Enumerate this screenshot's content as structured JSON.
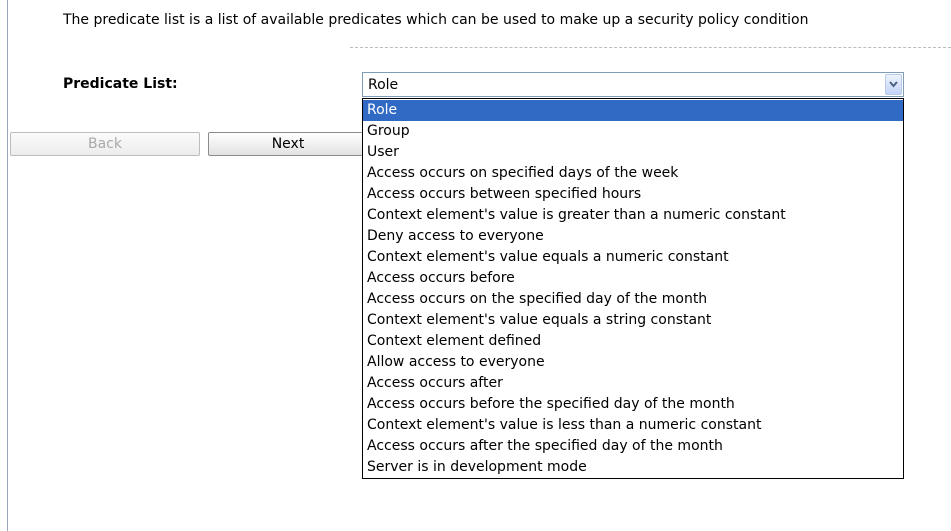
{
  "intro_text": "The predicate list is a list of available predicates which can be used to make up a security policy condition",
  "predicate_list": {
    "label": "Predicate List:",
    "selected": "Role",
    "options": [
      "Role",
      "Group",
      "User",
      "Access occurs on specified days of the week",
      "Access occurs between specified hours",
      "Context element's value is greater than a numeric constant",
      "Deny access to everyone",
      "Context element's value equals a numeric constant",
      "Access occurs before",
      "Access occurs on the specified day of the month",
      "Context element's value equals a string constant",
      "Context element defined",
      "Allow access to everyone",
      "Access occurs after",
      "Access occurs before the specified day of the month",
      "Context element's value is less than a numeric constant",
      "Access occurs after the specified day of the month",
      "Server is in development mode"
    ],
    "highlighted_index": 0
  },
  "buttons": {
    "back_label": "Back",
    "next_label": "Next"
  },
  "icons": {
    "dropdown_arrow": "chevron-down-icon"
  },
  "colors": {
    "highlight": "#316ac5",
    "dropdown_arrow": "#4d6185",
    "border": "#7f9db9"
  }
}
